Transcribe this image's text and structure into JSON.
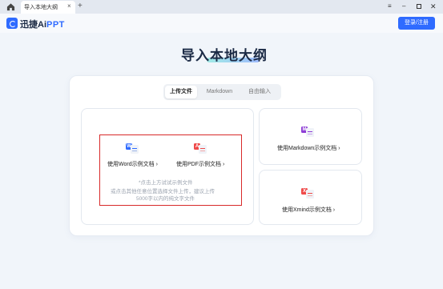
{
  "browser": {
    "tab_title": "导入本地大纲",
    "tab_close": "×",
    "new_tab": "+",
    "menu_glyph": "≡",
    "minimize_glyph": "–",
    "close_glyph": "✕"
  },
  "header": {
    "logo_text_main": "迅捷Ai",
    "logo_text_accent": "PPT",
    "login_label": "登录/注册"
  },
  "page": {
    "title": "导入本地大纲"
  },
  "tabs": [
    {
      "label": "上传文件",
      "active": true
    },
    {
      "label": "Markdown",
      "active": false
    },
    {
      "label": "自由输入",
      "active": false
    }
  ],
  "upload_card": {
    "word_link": "使用Word示例文档",
    "pdf_link": "使用PDF示例文档",
    "hint_line1": "*点击上方试试示例文件",
    "hint_line2": "或点击其他任意位置选择文件上传，建议上传",
    "hint_line3": "5000字以内的纯文字文件"
  },
  "markdown_card": {
    "link": "使用Markdown示例文档"
  },
  "xmind_card": {
    "link": "使用Xmind示例文档"
  },
  "chevron": "›",
  "icons": {
    "word_badge": "W",
    "pdf_badge": "A",
    "md_badge": "M",
    "xmind_badge": "X"
  },
  "colors": {
    "accent": "#2f6bff",
    "word": "#2f6bff",
    "pdf": "#ef4a4a",
    "markdown": "#8e3ed6",
    "xmind": "#ef4a4a",
    "highlight_border": "#d82a2a"
  }
}
